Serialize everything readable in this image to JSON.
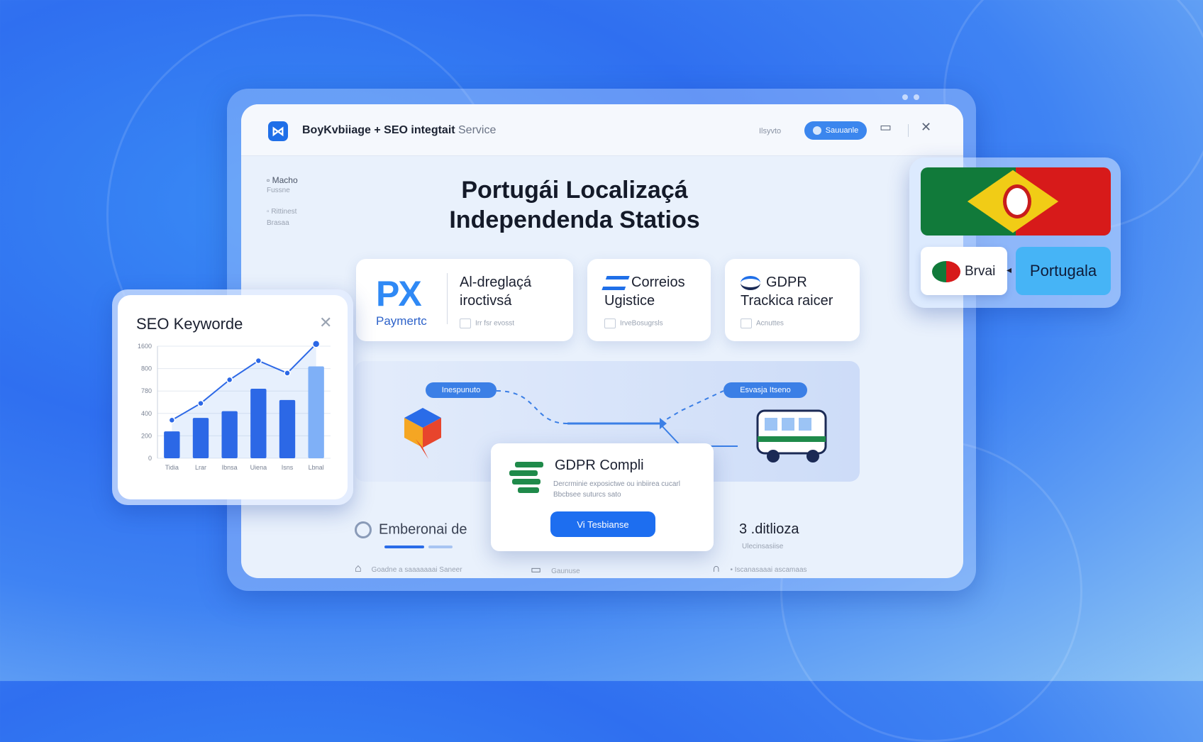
{
  "app": {
    "title": "BoyKvbiiage + SEO integtait",
    "subtitle": "Service",
    "tb_label": "Ilsyvto",
    "tb_button": "Sauuanle",
    "square_icon": "square-icon",
    "close_icon": "close-icon"
  },
  "sidebar": {
    "items": [
      {
        "label": "Macho",
        "sub": "Fussne"
      },
      {
        "label": "Rittinest",
        "sub": "Brasaa"
      }
    ]
  },
  "hero": {
    "line1": "Portugái Localizaçá",
    "line2": "Independenda Statios"
  },
  "cards": [
    {
      "logo": "PX",
      "logo_sub": "Paymertc",
      "title1": "Al-dreglaçá",
      "title2": "iroctivsá",
      "meta": "Irr fsr evosst"
    },
    {
      "title1": "Correios",
      "title2": "Ugistice",
      "meta": "IrveBosugrsls"
    },
    {
      "title1": "GDPR",
      "title2": "Trackica raicer",
      "meta": "Acnuttes"
    }
  ],
  "flow": {
    "pill_left": "Inespunuto",
    "pill_right": "Esvasja Itseno"
  },
  "gdpr_popup": {
    "title": "GDPR Compli",
    "desc": "Dercrminie exposictwe ou inbiirea cucarl Bbcbsee suturcs sato",
    "button": "Vi Tesbianse"
  },
  "bottom": {
    "left_title": "Emberonai de",
    "right_title": "3 .ditlioza",
    "right_sub": "Ulecinsasiise",
    "row_left": "Goadne a saaaaaaai Saneer",
    "row_mid": "Gaunuse",
    "row_right": "• Iscanasaaai ascamaas"
  },
  "seo": {
    "title": "SEO Keyworde",
    "close_icon": "close-icon"
  },
  "chart_data": {
    "type": "bar",
    "categories": [
      "Tidia",
      "Lrar",
      "Ibnsa",
      "Uiena",
      "Isns",
      "Lbnal"
    ],
    "values": [
      240,
      360,
      420,
      620,
      520,
      820
    ],
    "series": [
      {
        "values": [
          240,
          360,
          420,
          620,
          520,
          820
        ]
      },
      {
        "values": [
          340,
          490,
          700,
          870,
          760,
          1020
        ]
      }
    ],
    "y_ticks": [
      "0",
      "200",
      "400",
      "780",
      "800",
      "1600"
    ],
    "ylim": [
      0,
      1000
    ],
    "grid": true
  },
  "languages": {
    "left": "Brvai",
    "right": "Portugala"
  },
  "colors": {
    "accent": "#1d6ef0",
    "flag_green": "#117a3a",
    "flag_red": "#d71a1a"
  }
}
